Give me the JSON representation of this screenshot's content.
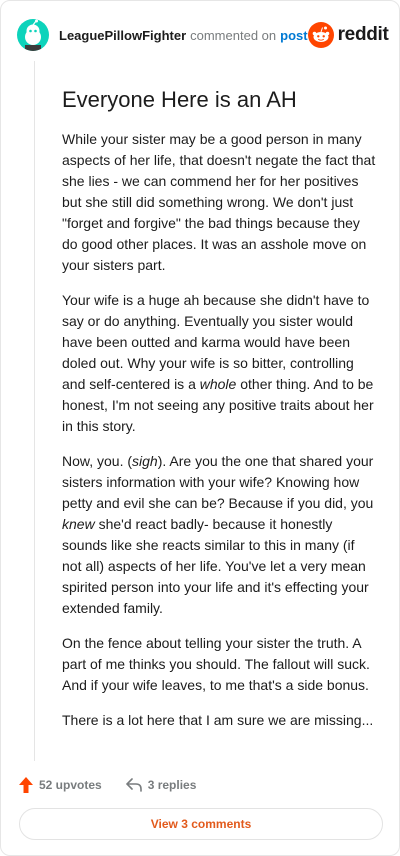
{
  "header": {
    "username": "LeaguePillowFighter",
    "meta": "commented on",
    "post_link": "post",
    "brand": "reddit"
  },
  "comment": {
    "title": "Everyone Here is an AH",
    "paragraphs": [
      "While your sister may be a good person in many aspects of her life, that doesn't negate the fact that she lies - we can commend her for her positives but she still did something wrong. We don't just \"forget and forgive\" the bad things because they do good other places. It was an asshole move on your sisters part.",
      "On the fence about telling your sister the truth. A part of me thinks you should. The fallout will suck. And if your wife leaves, to me that's a side bonus.",
      "There is a lot here that I am sure we are missing..."
    ],
    "p2": {
      "a": "Your wife is a huge ah because she didn't have to say or do anything. Eventually you sister would have been outted and karma would have been doled out. Why your wife is so bitter, controlling and self-centered is a ",
      "em": "whole",
      "b": " other thing. And to be honest, I'm not seeing any positive traits about her in this story."
    },
    "p3": {
      "a": "Now, you. (",
      "em1": "sigh",
      "b": "). Are you the one that shared your sisters information with your wife? Knowing how petty and evil she can be? Because if you did, you ",
      "em2": "knew",
      "c": " she'd react badly- because it honestly sounds like she reacts similar to this in many (if not all) aspects of her life. You've let a very mean spirited person into your life and it's effecting your extended family."
    }
  },
  "footer": {
    "upvotes": "52 upvotes",
    "replies": "3 replies",
    "view_button": "View 3 comments"
  },
  "colors": {
    "avatar": "#0dd3bb",
    "reddit_orange": "#ff4500",
    "link_blue": "#0079d3",
    "view_text": "#e25a1c"
  },
  "icons": [
    "avatar-snoo-icon",
    "reddit-logo-icon",
    "upvote-arrow-icon",
    "reply-arrow-icon"
  ]
}
